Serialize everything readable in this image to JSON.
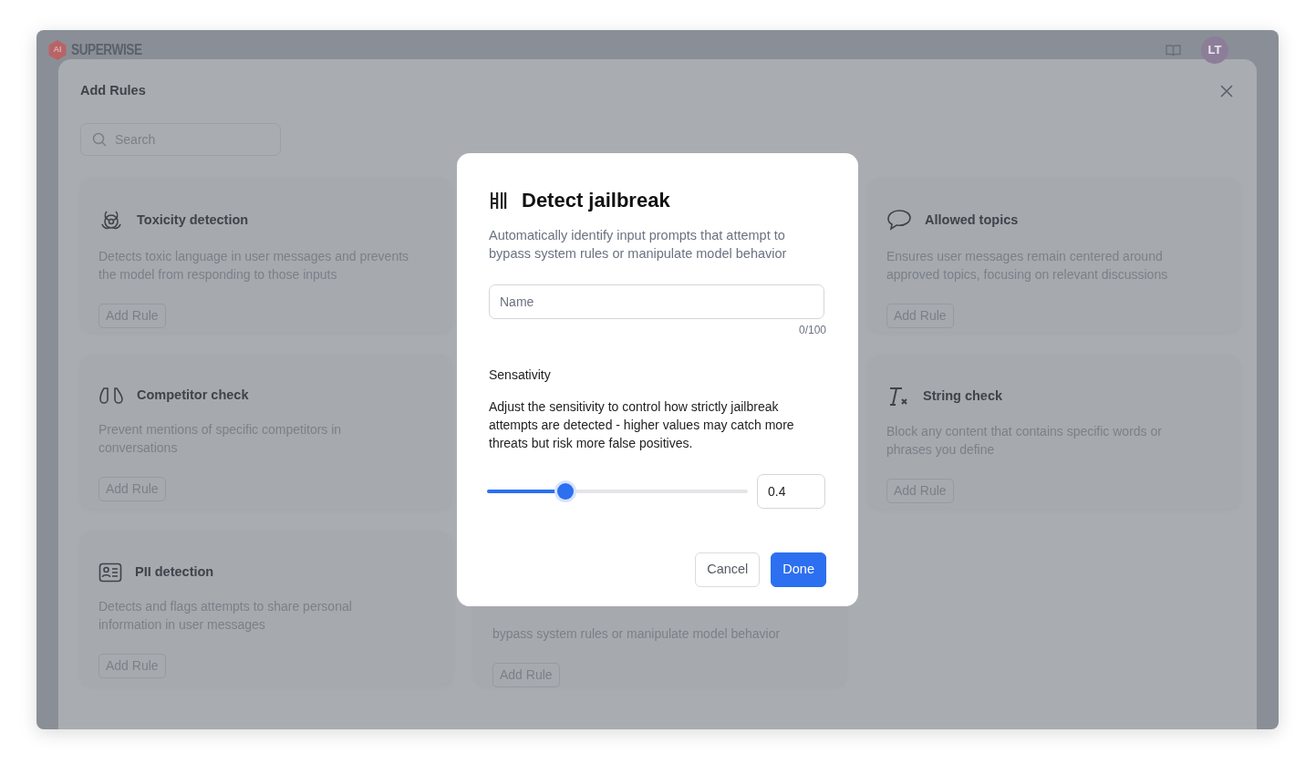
{
  "app_header": {
    "logo_badge": "AI",
    "logo_text": "SUPERWISE",
    "avatar": "LT"
  },
  "panel": {
    "title": "Add Rules",
    "search": {
      "placeholder": "Search"
    },
    "columns": [
      [
        {
          "kind": "rule",
          "title": "Toxicity detection",
          "description": "Detects toxic language in user messages and prevents the model from responding to those inputs",
          "button": "Add Rule"
        },
        {
          "kind": "rule",
          "title": "Competitor check",
          "description": "Prevent mentions of specific competitors in conversations",
          "button": "Add Rule"
        },
        {
          "kind": "rule",
          "title": "PII detection",
          "description": "Detects and flags attempts to share personal information in user messages",
          "button": "Add Rule"
        }
      ],
      [
        {
          "kind": "partial",
          "description": "bypass system rules or manipulate model behavior",
          "button": "Add Rule"
        }
      ],
      [
        {
          "kind": "rule",
          "title": "Allowed topics",
          "description": "Ensures user messages remain centered around approved topics, focusing on relevant discussions",
          "button": "Add Rule"
        },
        {
          "kind": "rule",
          "title": "String check",
          "description": "Block any content that contains specific words or phrases you define",
          "button": "Add Rule"
        }
      ]
    ]
  },
  "dialog": {
    "title": "Detect jailbreak",
    "subtitle": "Automatically identify input prompts that attempt to bypass system rules or manipulate model behavior",
    "name_field": {
      "placeholder": "Name",
      "counter": "0/100"
    },
    "section_label": "Sensativity",
    "section_text": "Adjust the sensitivity to control how strictly jailbreak attempts are detected - higher values may catch more threats but risk more false positives.",
    "slider": {
      "level": 0.3,
      "value": "0.4"
    },
    "buttons": [
      {
        "kind": "secondary",
        "label": "Cancel"
      },
      {
        "kind": "primary",
        "label": "Done"
      }
    ]
  }
}
